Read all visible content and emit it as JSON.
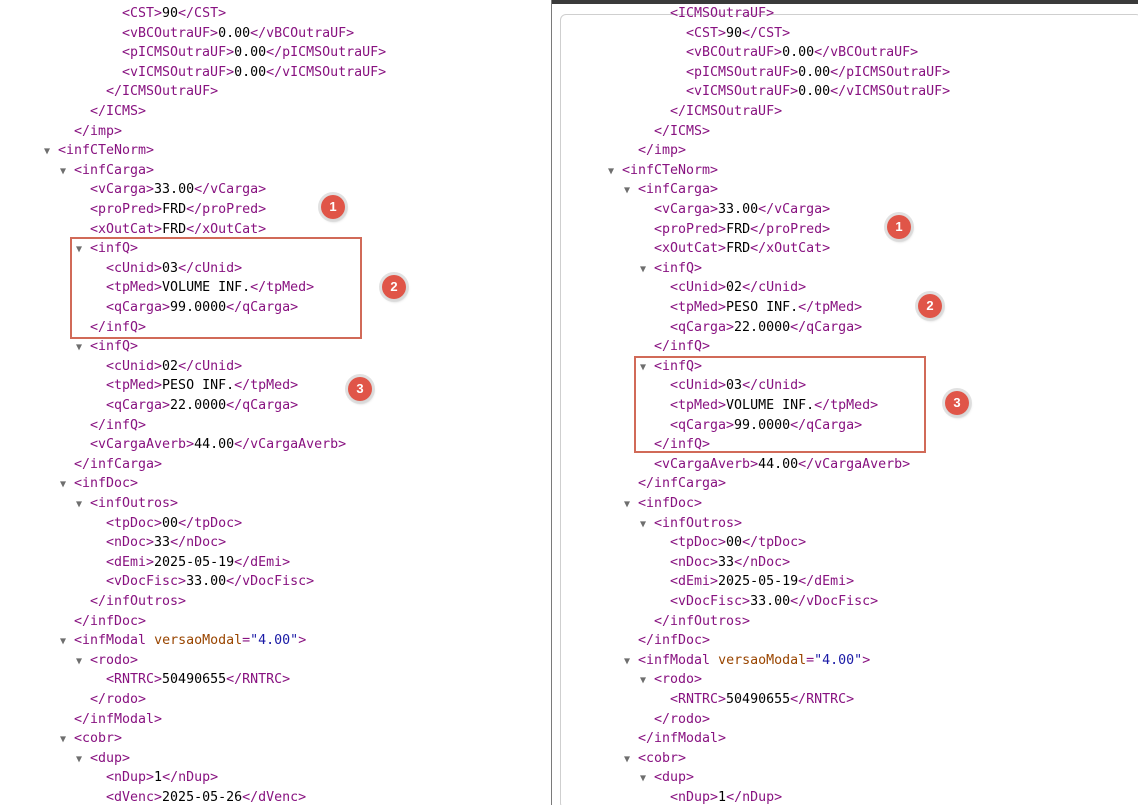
{
  "left_pane": {
    "lines": [
      {
        "indent": 1,
        "arrow": false,
        "tag_open": "<CST>",
        "text": "90",
        "tag_close": "</CST>"
      },
      {
        "indent": 1,
        "arrow": false,
        "tag_open": "<vBCOutraUF>",
        "text": "0.00",
        "tag_close": "</vBCOutraUF>"
      },
      {
        "indent": 1,
        "arrow": false,
        "tag_open": "<pICMSOutraUF>",
        "text": "0.00",
        "tag_close": "</pICMSOutraUF>"
      },
      {
        "indent": 1,
        "arrow": false,
        "tag_open": "<vICMSOutraUF>",
        "text": "0.00",
        "tag_close": "</vICMSOutraUF>"
      },
      {
        "indent": 0,
        "arrow": false,
        "tag_open": "</ICMSOutraUF>"
      },
      {
        "indent": -1,
        "arrow": false,
        "tag_open": "</ICMS>"
      },
      {
        "indent": -2,
        "arrow": false,
        "tag_open": "</imp>"
      },
      {
        "indent": -3,
        "arrow": true,
        "tag_open": "<infCTeNorm>"
      },
      {
        "indent": -2,
        "arrow": true,
        "tag_open": "<infCarga>"
      },
      {
        "indent": -1,
        "arrow": false,
        "tag_open": "<vCarga>",
        "text": "33.00",
        "tag_close": "</vCarga>"
      },
      {
        "indent": -1,
        "arrow": false,
        "tag_open": "<proPred>",
        "text": "FRD",
        "tag_close": "</proPred>"
      },
      {
        "indent": -1,
        "arrow": false,
        "tag_open": "<xOutCat>",
        "text": "FRD",
        "tag_close": "</xOutCat>"
      },
      {
        "indent": -1,
        "arrow": true,
        "tag_open": "<infQ>"
      },
      {
        "indent": 0,
        "arrow": false,
        "tag_open": "<cUnid>",
        "text": "03",
        "tag_close": "</cUnid>"
      },
      {
        "indent": 0,
        "arrow": false,
        "tag_open": "<tpMed>",
        "text": "VOLUME INF.",
        "tag_close": "</tpMed>"
      },
      {
        "indent": 0,
        "arrow": false,
        "tag_open": "<qCarga>",
        "text": "99.0000",
        "tag_close": "</qCarga>"
      },
      {
        "indent": -1,
        "arrow": false,
        "tag_open": "</infQ>"
      },
      {
        "indent": -1,
        "arrow": true,
        "tag_open": "<infQ>"
      },
      {
        "indent": 0,
        "arrow": false,
        "tag_open": "<cUnid>",
        "text": "02",
        "tag_close": "</cUnid>"
      },
      {
        "indent": 0,
        "arrow": false,
        "tag_open": "<tpMed>",
        "text": "PESO INF.",
        "tag_close": "</tpMed>"
      },
      {
        "indent": 0,
        "arrow": false,
        "tag_open": "<qCarga>",
        "text": "22.0000",
        "tag_close": "</qCarga>"
      },
      {
        "indent": -1,
        "arrow": false,
        "tag_open": "</infQ>"
      },
      {
        "indent": -1,
        "arrow": false,
        "tag_open": "<vCargaAverb>",
        "text": "44.00",
        "tag_close": "</vCargaAverb>"
      },
      {
        "indent": -2,
        "arrow": false,
        "tag_open": "</infCarga>"
      },
      {
        "indent": -2,
        "arrow": true,
        "tag_open": "<infDoc>"
      },
      {
        "indent": -1,
        "arrow": true,
        "tag_open": "<infOutros>"
      },
      {
        "indent": 0,
        "arrow": false,
        "tag_open": "<tpDoc>",
        "text": "00",
        "tag_close": "</tpDoc>"
      },
      {
        "indent": 0,
        "arrow": false,
        "tag_open": "<nDoc>",
        "text": "33",
        "tag_close": "</nDoc>"
      },
      {
        "indent": 0,
        "arrow": false,
        "tag_open": "<dEmi>",
        "text": "2025-05-19",
        "tag_close": "</dEmi>"
      },
      {
        "indent": 0,
        "arrow": false,
        "tag_open": "<vDocFisc>",
        "text": "33.00",
        "tag_close": "</vDocFisc>"
      },
      {
        "indent": -1,
        "arrow": false,
        "tag_open": "</infOutros>"
      },
      {
        "indent": -2,
        "arrow": false,
        "tag_open": "</infDoc>"
      },
      {
        "indent": -2,
        "arrow": true,
        "tag_open": "<infModal",
        "attr_name": "versaoModal",
        "attr_value": "\"4.00\"",
        "tag_tail": ">"
      },
      {
        "indent": -1,
        "arrow": true,
        "tag_open": "<rodo>"
      },
      {
        "indent": 0,
        "arrow": false,
        "tag_open": "<RNTRC>",
        "text": "50490655",
        "tag_close": "</RNTRC>"
      },
      {
        "indent": -1,
        "arrow": false,
        "tag_open": "</rodo>"
      },
      {
        "indent": -2,
        "arrow": false,
        "tag_open": "</infModal>"
      },
      {
        "indent": -2,
        "arrow": true,
        "tag_open": "<cobr>"
      },
      {
        "indent": -1,
        "arrow": true,
        "tag_open": "<dup>"
      },
      {
        "indent": 0,
        "arrow": false,
        "tag_open": "<nDup>",
        "text": "1",
        "tag_close": "</nDup>"
      },
      {
        "indent": 0,
        "arrow": false,
        "tag_open": "<dVenc>",
        "text": "2025-05-26",
        "tag_close": "</dVenc>"
      }
    ],
    "badges": [
      "1",
      "2",
      "3"
    ]
  },
  "right_pane": {
    "lines": [
      {
        "indent": 0,
        "arrow": false,
        "tag_open": "<ICMSOutraUF>"
      },
      {
        "indent": 1,
        "arrow": false,
        "tag_open": "<CST>",
        "text": "90",
        "tag_close": "</CST>"
      },
      {
        "indent": 1,
        "arrow": false,
        "tag_open": "<vBCOutraUF>",
        "text": "0.00",
        "tag_close": "</vBCOutraUF>"
      },
      {
        "indent": 1,
        "arrow": false,
        "tag_open": "<pICMSOutraUF>",
        "text": "0.00",
        "tag_close": "</pICMSOutraUF>"
      },
      {
        "indent": 1,
        "arrow": false,
        "tag_open": "<vICMSOutraUF>",
        "text": "0.00",
        "tag_close": "</vICMSOutraUF>"
      },
      {
        "indent": 0,
        "arrow": false,
        "tag_open": "</ICMSOutraUF>"
      },
      {
        "indent": -1,
        "arrow": false,
        "tag_open": "</ICMS>"
      },
      {
        "indent": -2,
        "arrow": false,
        "tag_open": "</imp>"
      },
      {
        "indent": -3,
        "arrow": true,
        "tag_open": "<infCTeNorm>"
      },
      {
        "indent": -2,
        "arrow": true,
        "tag_open": "<infCarga>"
      },
      {
        "indent": -1,
        "arrow": false,
        "tag_open": "<vCarga>",
        "text": "33.00",
        "tag_close": "</vCarga>"
      },
      {
        "indent": -1,
        "arrow": false,
        "tag_open": "<proPred>",
        "text": "FRD",
        "tag_close": "</proPred>"
      },
      {
        "indent": -1,
        "arrow": false,
        "tag_open": "<xOutCat>",
        "text": "FRD",
        "tag_close": "</xOutCat>"
      },
      {
        "indent": -1,
        "arrow": true,
        "tag_open": "<infQ>"
      },
      {
        "indent": 0,
        "arrow": false,
        "tag_open": "<cUnid>",
        "text": "02",
        "tag_close": "</cUnid>"
      },
      {
        "indent": 0,
        "arrow": false,
        "tag_open": "<tpMed>",
        "text": "PESO INF.",
        "tag_close": "</tpMed>"
      },
      {
        "indent": 0,
        "arrow": false,
        "tag_open": "<qCarga>",
        "text": "22.0000",
        "tag_close": "</qCarga>"
      },
      {
        "indent": -1,
        "arrow": false,
        "tag_open": "</infQ>"
      },
      {
        "indent": -1,
        "arrow": true,
        "tag_open": "<infQ>"
      },
      {
        "indent": 0,
        "arrow": false,
        "tag_open": "<cUnid>",
        "text": "03",
        "tag_close": "</cUnid>"
      },
      {
        "indent": 0,
        "arrow": false,
        "tag_open": "<tpMed>",
        "text": "VOLUME INF.",
        "tag_close": "</tpMed>"
      },
      {
        "indent": 0,
        "arrow": false,
        "tag_open": "<qCarga>",
        "text": "99.0000",
        "tag_close": "</qCarga>"
      },
      {
        "indent": -1,
        "arrow": false,
        "tag_open": "</infQ>"
      },
      {
        "indent": -1,
        "arrow": false,
        "tag_open": "<vCargaAverb>",
        "text": "44.00",
        "tag_close": "</vCargaAverb>"
      },
      {
        "indent": -2,
        "arrow": false,
        "tag_open": "</infCarga>"
      },
      {
        "indent": -2,
        "arrow": true,
        "tag_open": "<infDoc>"
      },
      {
        "indent": -1,
        "arrow": true,
        "tag_open": "<infOutros>"
      },
      {
        "indent": 0,
        "arrow": false,
        "tag_open": "<tpDoc>",
        "text": "00",
        "tag_close": "</tpDoc>"
      },
      {
        "indent": 0,
        "arrow": false,
        "tag_open": "<nDoc>",
        "text": "33",
        "tag_close": "</nDoc>"
      },
      {
        "indent": 0,
        "arrow": false,
        "tag_open": "<dEmi>",
        "text": "2025-05-19",
        "tag_close": "</dEmi>"
      },
      {
        "indent": 0,
        "arrow": false,
        "tag_open": "<vDocFisc>",
        "text": "33.00",
        "tag_close": "</vDocFisc>"
      },
      {
        "indent": -1,
        "arrow": false,
        "tag_open": "</infOutros>"
      },
      {
        "indent": -2,
        "arrow": false,
        "tag_open": "</infDoc>"
      },
      {
        "indent": -2,
        "arrow": true,
        "tag_open": "<infModal",
        "attr_name": "versaoModal",
        "attr_value": "\"4.00\"",
        "tag_tail": ">"
      },
      {
        "indent": -1,
        "arrow": true,
        "tag_open": "<rodo>"
      },
      {
        "indent": 0,
        "arrow": false,
        "tag_open": "<RNTRC>",
        "text": "50490655",
        "tag_close": "</RNTRC>"
      },
      {
        "indent": -1,
        "arrow": false,
        "tag_open": "</rodo>"
      },
      {
        "indent": -2,
        "arrow": false,
        "tag_open": "</infModal>"
      },
      {
        "indent": -2,
        "arrow": true,
        "tag_open": "<cobr>"
      },
      {
        "indent": -1,
        "arrow": true,
        "tag_open": "<dup>"
      },
      {
        "indent": 0,
        "arrow": false,
        "tag_open": "<nDup>",
        "text": "1",
        "tag_close": "</nDup>"
      }
    ],
    "badges": [
      "1",
      "2",
      "3"
    ]
  },
  "colors": {
    "tag": "#881280",
    "text": "#000000",
    "attr_name": "#994500",
    "attr_value": "#1a1aa6",
    "highlight_box": "#d16a58",
    "badge": "#e05548"
  }
}
